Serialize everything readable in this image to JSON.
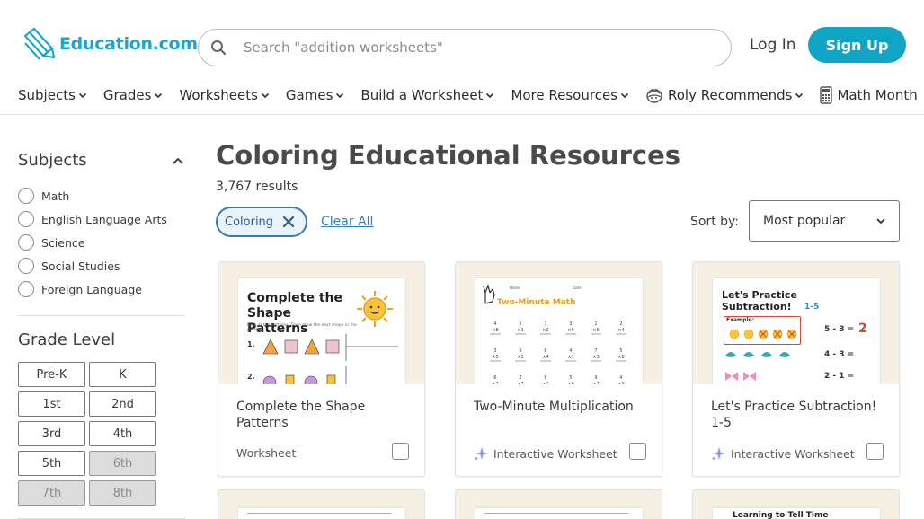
{
  "brand": {
    "name": "Education.com",
    "accent": "#10a5c4"
  },
  "header": {
    "search_placeholder": "Search \"addition worksheets\"",
    "login": "Log In",
    "signup": "Sign Up"
  },
  "nav": {
    "items": [
      {
        "label": "Subjects"
      },
      {
        "label": "Grades"
      },
      {
        "label": "Worksheets"
      },
      {
        "label": "Games"
      },
      {
        "label": "Build a Worksheet"
      },
      {
        "label": "More Resources"
      },
      {
        "label": "Roly Recommends"
      },
      {
        "label": "Math Month"
      }
    ]
  },
  "sidebar": {
    "subjects_heading": "Subjects",
    "subjects": [
      "Math",
      "English Language Arts",
      "Science",
      "Social Studies",
      "Foreign Language"
    ],
    "grade_heading": "Grade Level",
    "grades": [
      {
        "label": "Pre-K",
        "available": true
      },
      {
        "label": "K",
        "available": true
      },
      {
        "label": "1st",
        "available": true
      },
      {
        "label": "2nd",
        "available": true
      },
      {
        "label": "3rd",
        "available": true
      },
      {
        "label": "4th",
        "available": true
      },
      {
        "label": "5th",
        "available": true
      },
      {
        "label": "6th",
        "available": false
      },
      {
        "label": "7th",
        "available": false
      },
      {
        "label": "8th",
        "available": false
      }
    ]
  },
  "main": {
    "title": "Coloring Educational Resources",
    "results": "3,767 results",
    "chip": "Coloring",
    "clear_all": "Clear All",
    "sort_label": "Sort by:",
    "sort_value": "Most popular"
  },
  "cards": [
    {
      "title": "Complete the Shape Patterns",
      "type": "Worksheet",
      "interactive": false,
      "preview": {
        "heading": "Complete the Shape Patterns",
        "instruction": "Look at the patterns. Then draw the next shape in the pattern."
      }
    },
    {
      "title": "Two-Minute Multiplication",
      "type": "Interactive Worksheet",
      "interactive": true,
      "preview": {
        "heading": "Two-Minute Math",
        "name_label": "Name",
        "date_label": "Date"
      }
    },
    {
      "title": "Let's Practice Subtraction! 1-5",
      "type": "Interactive Worksheet",
      "interactive": true,
      "preview": {
        "heading": "Let's Practice Subtraction!",
        "range": "1-5",
        "example": "Example:",
        "eq1": "5 - 3 =",
        "ans1": "2",
        "eq2": "4 - 3 =",
        "eq3": "2 - 1 ="
      }
    }
  ],
  "cards_row2": [
    {
      "preview_heading": ""
    },
    {
      "preview_heading": ""
    },
    {
      "preview_heading": "Learning to Tell Time"
    }
  ]
}
